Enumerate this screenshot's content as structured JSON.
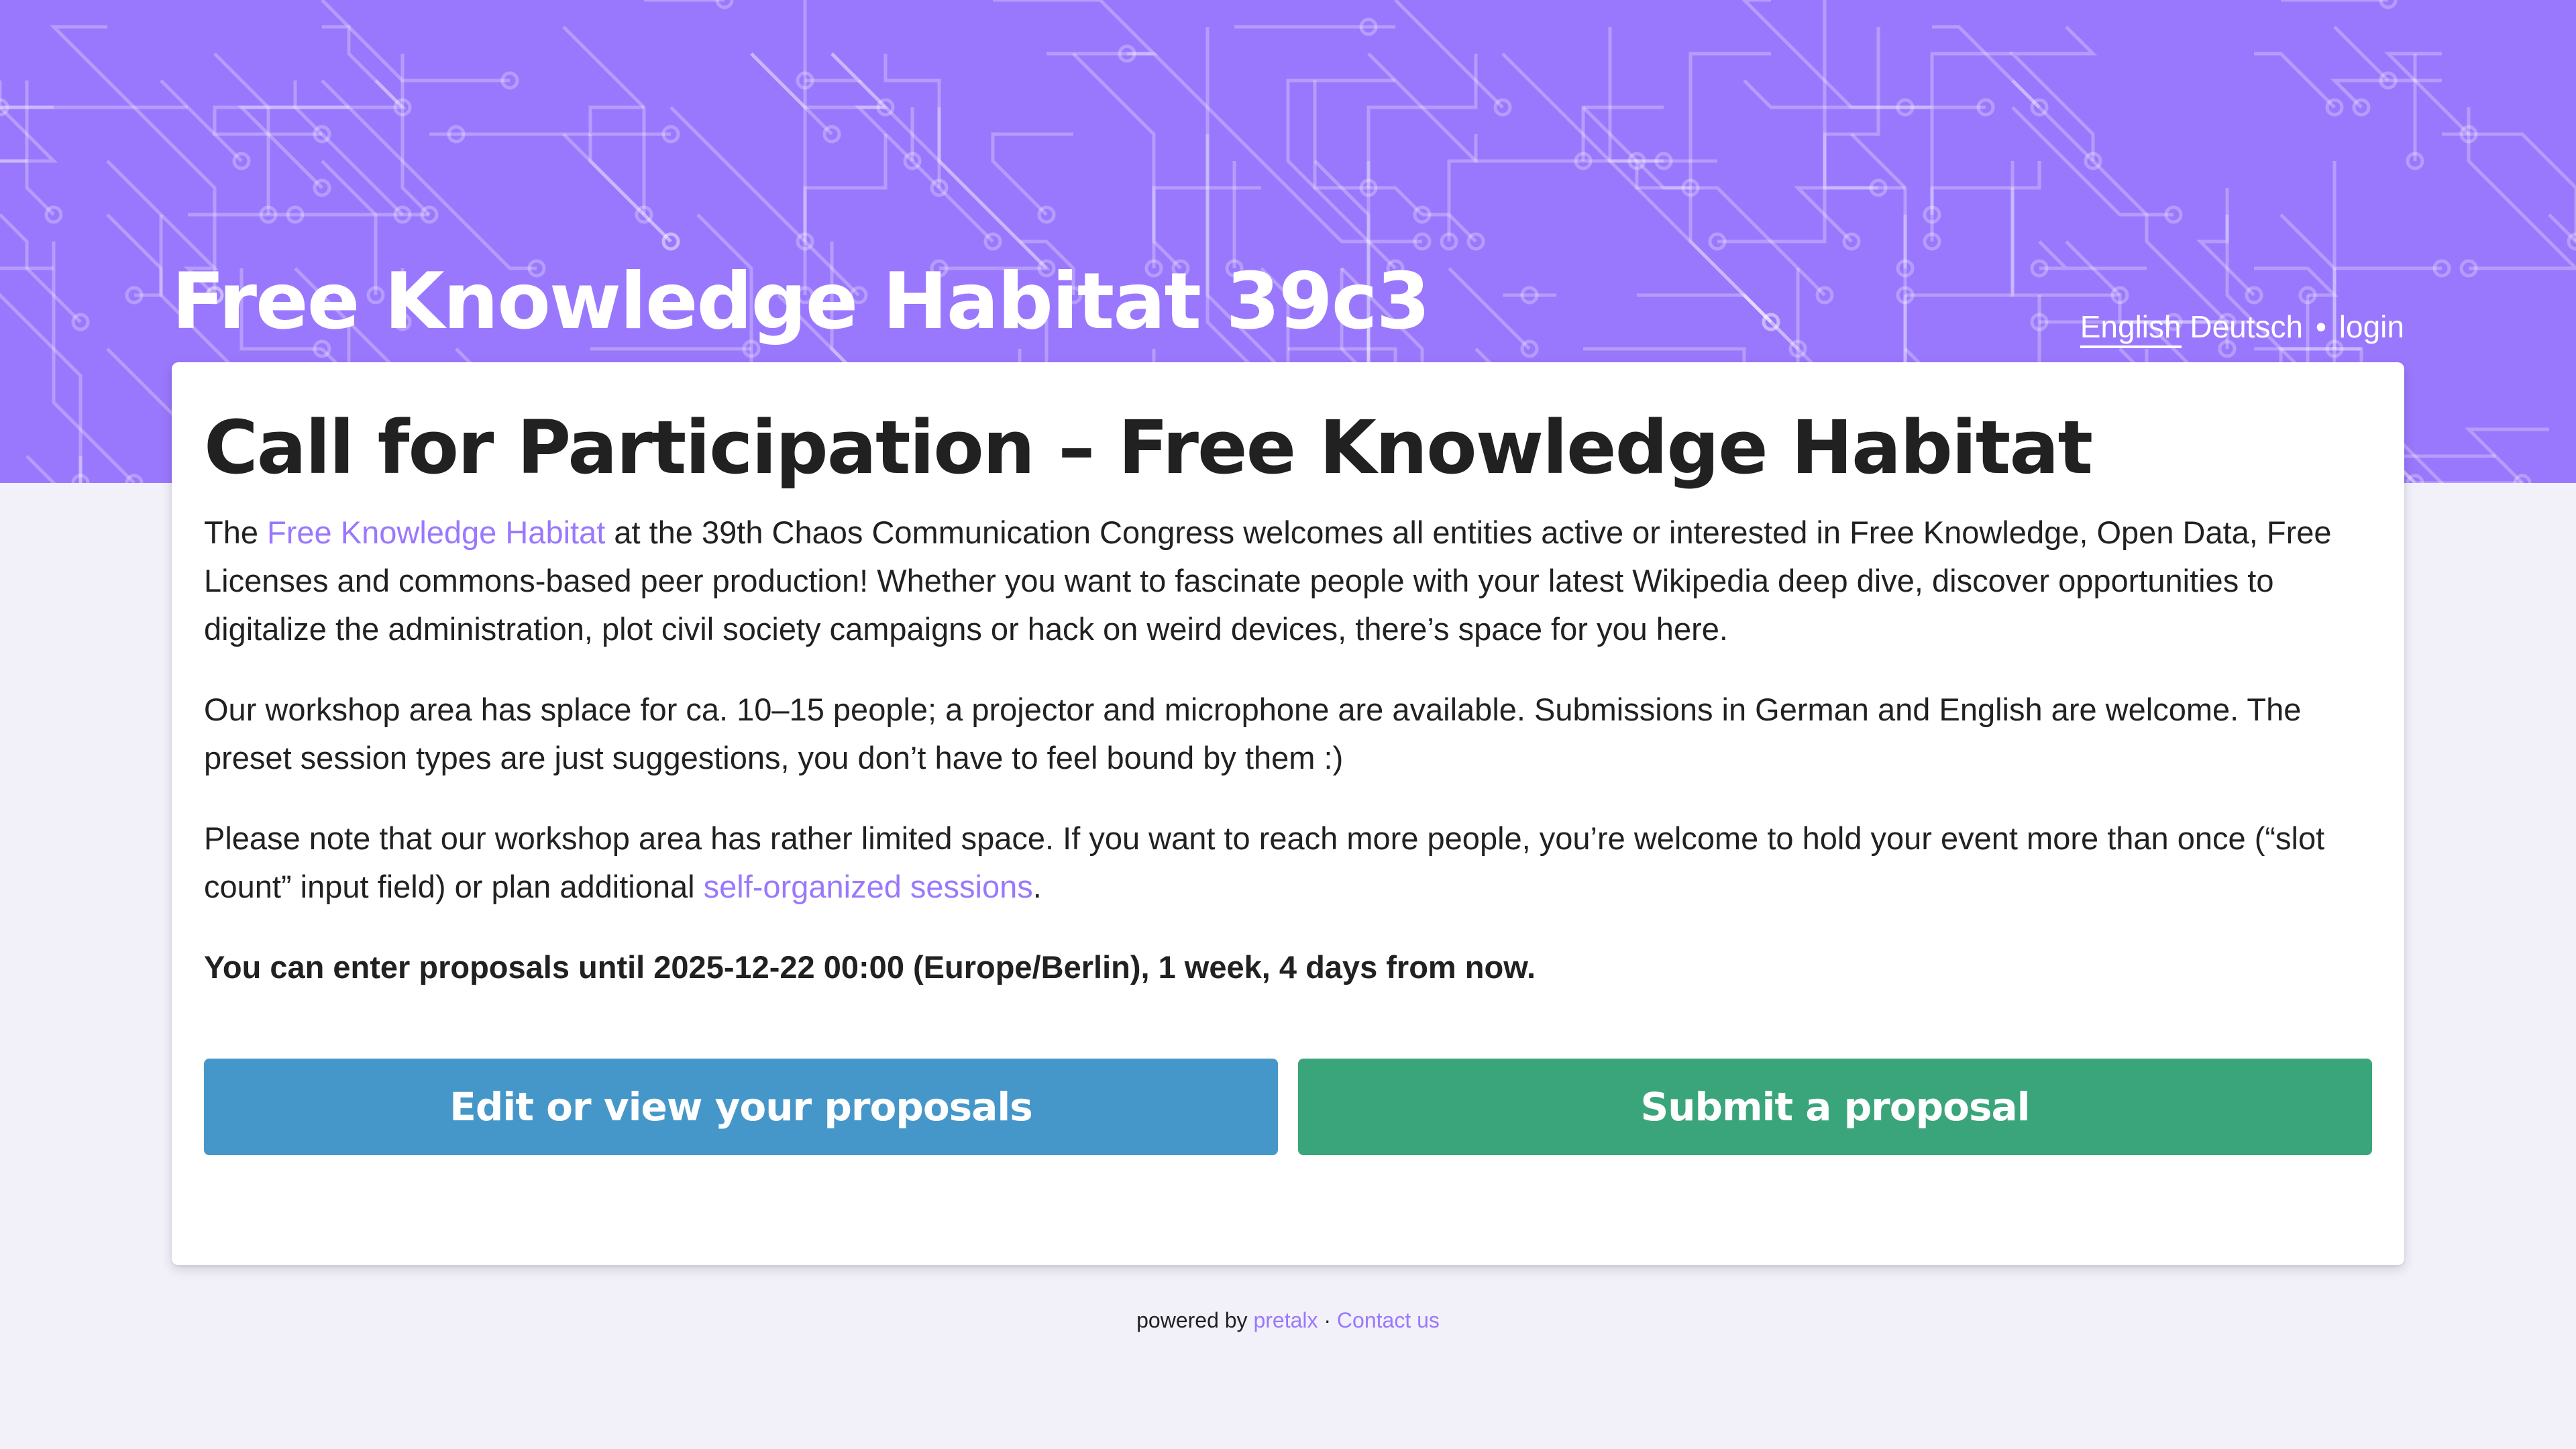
{
  "header": {
    "event_title": "Free Knowledge Habitat 39c3",
    "nav": {
      "lang_english": "English",
      "lang_deutsch": "Deutsch",
      "separator": "•",
      "login": "login"
    }
  },
  "main": {
    "title": "Call for Participation – Free Knowledge Habitat",
    "p1_before": "The ",
    "p1_link": "Free Knowledge Habitat",
    "p1_after": " at the 39th Chaos Communication Congress welcomes all entities active or interested in Free Knowledge, Open Data, Free Licenses and commons-based peer production! Whether you want to fascinate people with your latest Wikipedia deep dive, discover opportunities to digitalize the administration, plot civil society campaigns or hack on weird devices, there’s space for you here.",
    "p2": "Our workshop area has splace for ca. 10–15 people; a projector and microphone are available. Submissions in German and English are welcome. The preset session types are just suggestions, you don’t have to feel bound by them :)",
    "p3_before": "Please note that our workshop area has rather limited space. If you want to reach more people, you’re welcome to hold your event more than once (“slot count” input field) or plan additional ",
    "p3_link": "self-organized sessions",
    "p3_after": ".",
    "deadline": "You can enter proposals until 2025-12-22 00:00 (Europe/Berlin), 1 week, 4 days from now.",
    "btn_edit": "Edit or view your proposals",
    "btn_submit": "Submit a proposal"
  },
  "footer": {
    "powered_by": "powered by ",
    "pretalx": "pretalx",
    "sep": " · ",
    "contact": "Contact us"
  },
  "colors": {
    "primary": "#9a78fd",
    "info": "#4697c9",
    "success": "#3aa57a",
    "background": "#f2f1fa"
  }
}
